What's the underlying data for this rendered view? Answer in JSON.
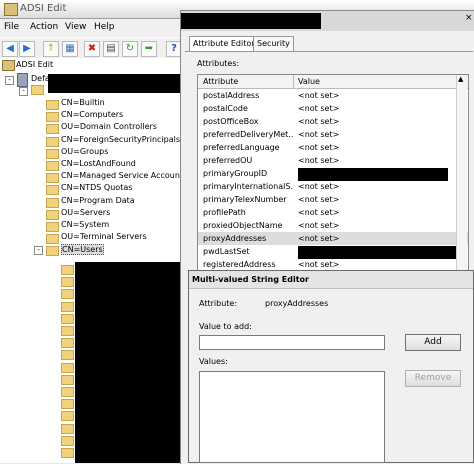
{
  "adsi": {
    "title": "ADSI Edit",
    "menu": [
      "File",
      "Action",
      "View",
      "Help"
    ],
    "tree": {
      "root": "ADSI Edit",
      "connection": "Defa",
      "items": [
        "CN=Builtin",
        "CN=Computers",
        "OU=Domain Controllers",
        "CN=ForeignSecurityPrincipals",
        "OU=Groups",
        "CN=LostAndFound",
        "CN=Managed Service Accounts",
        "CN=NTDS Quotas",
        "CN=Program Data",
        "OU=Servers",
        "CN=System",
        "OU=Terminal Servers",
        "CN=Users"
      ]
    }
  },
  "props": {
    "tabs": [
      "Attribute Editor",
      "Security"
    ],
    "attributes_label": "Attributes:",
    "columns": [
      "Attribute",
      "Value"
    ],
    "rows": [
      {
        "a": "postalAddress",
        "v": "<not set>"
      },
      {
        "a": "postalCode",
        "v": "<not set>"
      },
      {
        "a": "postOfficeBox",
        "v": "<not set>"
      },
      {
        "a": "preferredDeliveryMet...",
        "v": "<not set>"
      },
      {
        "a": "preferredLanguage",
        "v": "<not set>"
      },
      {
        "a": "preferredOU",
        "v": "<not set>"
      },
      {
        "a": "primaryGroupID",
        "v": ""
      },
      {
        "a": "primaryInternationalS...",
        "v": "<not set>"
      },
      {
        "a": "primaryTelexNumber",
        "v": "<not set>"
      },
      {
        "a": "profilePath",
        "v": "<not set>"
      },
      {
        "a": "proxiedObjectName",
        "v": "<not set>"
      },
      {
        "a": "proxyAddresses",
        "v": "<not set>"
      },
      {
        "a": "pwdLastSet",
        "v": ""
      },
      {
        "a": "registeredAddress",
        "v": "<not set>"
      }
    ]
  },
  "editor": {
    "title": "Multi-valued String Editor",
    "attribute_label": "Attribute:",
    "attribute_value": "proxyAddresses",
    "value_to_add_label": "Value to add:",
    "value_to_add": "",
    "values_label": "Values:",
    "add_label": "Add",
    "remove_label": "Remove"
  }
}
